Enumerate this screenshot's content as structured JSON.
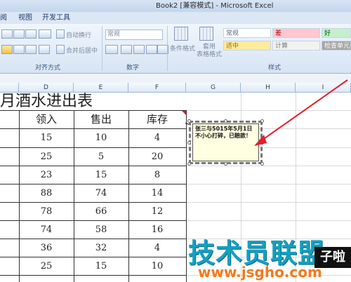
{
  "window": {
    "title": "Book2  [兼容模式] - Microsoft Excel"
  },
  "ribbon_tabs": [
    "阅",
    "视图",
    "开发工具"
  ],
  "ribbon": {
    "wrap_text": "自动换行",
    "merge_center": "合并后居中",
    "number_format": "常规",
    "conditional_format": "条件格式",
    "format_as_table": "套用\n表格格式",
    "align_group": "对齐方式",
    "number_group": "数字",
    "styles_group": "样式",
    "styles": {
      "normal": "常规",
      "bad": "差",
      "good": "好",
      "neutral": "适中",
      "calculation": "计算",
      "check_cell": "检查单元"
    },
    "colors": {
      "bad_bg": "#ffc7ce",
      "good_bg": "#c6efce",
      "neutral_bg": "#ffeb9c",
      "check_bg": "#a5a5a5"
    }
  },
  "columns": [
    "D",
    "E",
    "F",
    "G",
    "H",
    "I"
  ],
  "sheet": {
    "title": "月酒水进出表",
    "headers": [
      "领入",
      "售出",
      "库存"
    ],
    "rows": [
      [
        "15",
        "10",
        "4"
      ],
      [
        "25",
        "5",
        "20"
      ],
      [
        "23",
        "15",
        "8"
      ],
      [
        "88",
        "74",
        "14"
      ],
      [
        "78",
        "66",
        "12"
      ],
      [
        "74",
        "58",
        "16"
      ],
      [
        "36",
        "32",
        "4"
      ],
      [
        "25",
        "15",
        "10"
      ]
    ]
  },
  "comment": {
    "text": "张三与5015年5月1日不小心打碎，已赔款！"
  },
  "watermark": {
    "main": "技术员联盟",
    "url": "www.jsgho.com",
    "side": "子啦"
  },
  "accent": {
    "arrow": "#e0202a"
  }
}
